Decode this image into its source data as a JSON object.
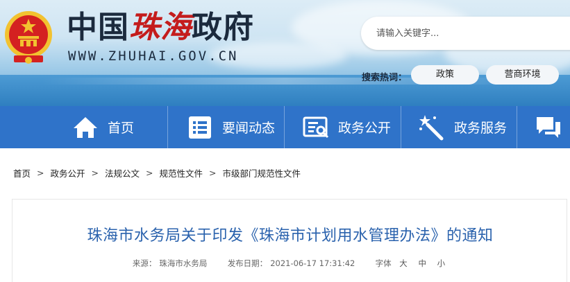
{
  "header": {
    "title_main": "中国",
    "title_accent": "珠海",
    "title_tail": "政府",
    "url": "WWW.ZHUHAI.GOV.CN",
    "search_placeholder": "请输入关键字...",
    "hot_label": "搜索热词：",
    "hot_words": [
      "政策",
      "营商环境"
    ]
  },
  "nav": {
    "items": [
      {
        "label": "首页",
        "icon": "home-icon"
      },
      {
        "label": "要闻动态",
        "icon": "news-list-icon"
      },
      {
        "label": "政务公开",
        "icon": "open-affairs-icon"
      },
      {
        "label": "政务服务",
        "icon": "service-wand-icon"
      },
      {
        "label": "",
        "icon": "chat-bubbles-icon"
      }
    ]
  },
  "breadcrumb": [
    "首页",
    "政务公开",
    "法规公文",
    "规范性文件",
    "市级部门规范性文件"
  ],
  "article": {
    "title": "珠海市水务局关于印发《珠海市计划用水管理办法》的通知",
    "source_label": "来源：",
    "source": "珠海市水务局",
    "date_label": "发布日期：",
    "date": "2021-06-17 17:31:42",
    "font_label": "字体",
    "font_sizes": [
      "大",
      "中",
      "小"
    ]
  },
  "colors": {
    "nav_bg": "#2f73c9",
    "title_blue": "#2a62ad",
    "accent_red": "#c41c1c"
  }
}
